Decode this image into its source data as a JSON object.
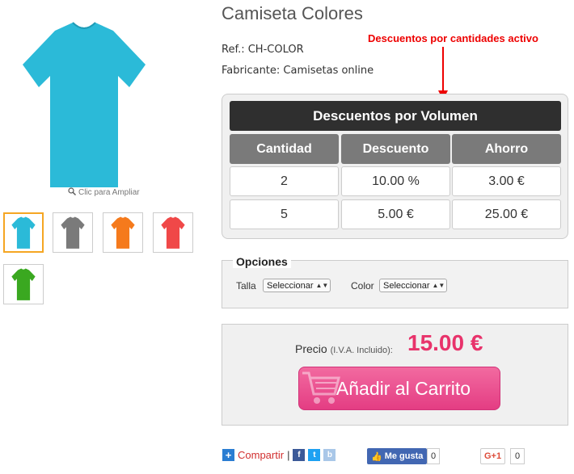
{
  "product": {
    "title": "Camiseta Colores",
    "ref": "Ref.: CH-COLOR",
    "manufacturer": "Fabricante: Camisetas online",
    "zoom_hint": "Clic para Ampliar",
    "main_color": "#2bbad8",
    "thumbnails": [
      {
        "color": "#2bbad8",
        "selected": true
      },
      {
        "color": "#7a7a7a",
        "selected": false
      },
      {
        "color": "#f57a1c",
        "selected": false
      },
      {
        "color": "#f04848",
        "selected": false
      },
      {
        "color": "#3aa820",
        "selected": false
      }
    ]
  },
  "annotation": "Descuentos por cantidades activo",
  "discounts": {
    "title": "Descuentos por Volumen",
    "headers": [
      "Cantidad",
      "Descuento",
      "Ahorro"
    ],
    "rows": [
      [
        "2",
        "10.00 %",
        "3.00 €"
      ],
      [
        "5",
        "5.00 €",
        "25.00 €"
      ]
    ]
  },
  "options": {
    "legend": "Opciones",
    "talla_label": "Talla",
    "talla_value": "Seleccionar",
    "color_label": "Color",
    "color_value": "Seleccionar"
  },
  "price": {
    "label": "Precio",
    "sub": "(I.V.A. Incluido):",
    "value": "15.00 €",
    "cart_button": "Añadir al Carrito"
  },
  "social": {
    "share": "Compartir",
    "like": "Me gusta",
    "like_count": "0",
    "gplus": "G+1",
    "gplus_count": "0"
  },
  "colors": {
    "accent_pink": "#e8336b",
    "annotation_red": "#e00000"
  }
}
